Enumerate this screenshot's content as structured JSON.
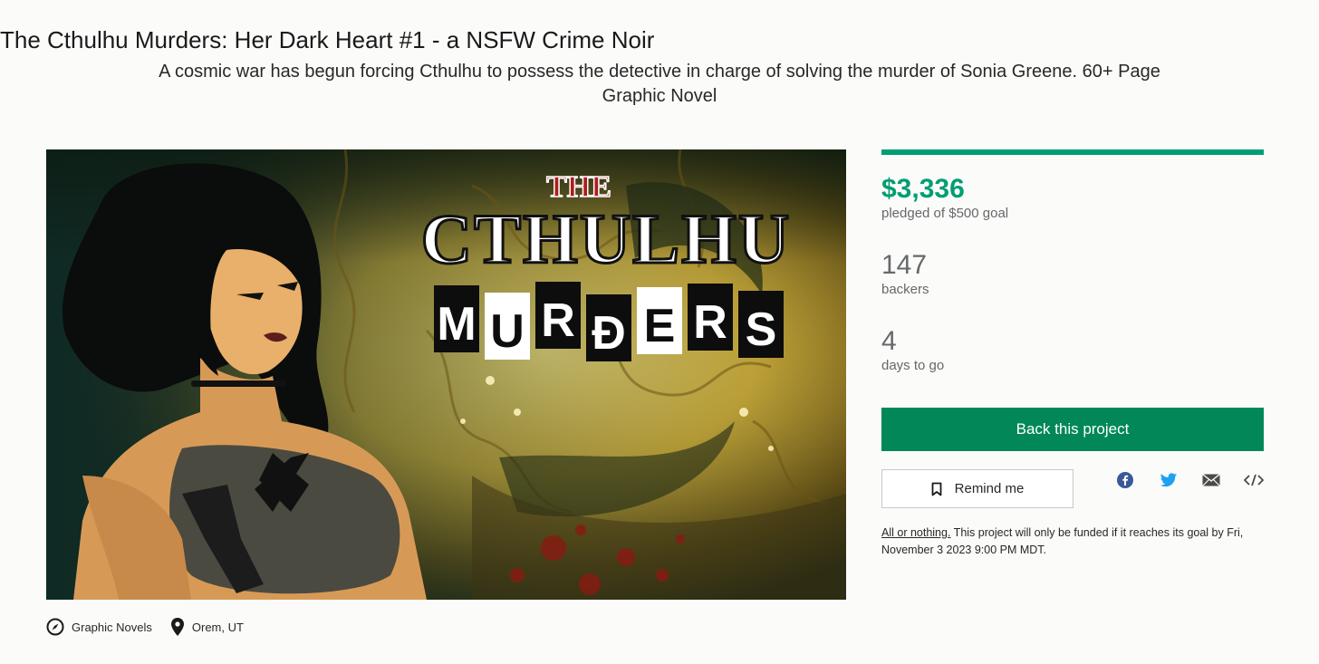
{
  "project": {
    "title": "The Cthulhu Murders: Her Dark Heart #1 - a NSFW Crime Noir",
    "blurb": "A cosmic war has begun forcing Cthulhu to possess the detective in charge of solving the murder of Sonia Greene. 60+ Page Graphic Novel"
  },
  "hero": {
    "logo_the": "THE",
    "logo_cthulhu": "CTHULHU",
    "logo_murders_letters": [
      "M",
      "U",
      "R",
      "Ð",
      "E",
      "R",
      "S"
    ]
  },
  "meta": {
    "category": "Graphic Novels",
    "category_icon": "compass-icon",
    "location": "Orem, UT",
    "location_icon": "map-pin-icon"
  },
  "funding": {
    "progress_fraction": 1.0,
    "pledged": "$3,336",
    "pledged_label": "pledged of $500 goal",
    "backers": "147",
    "backers_label": "backers",
    "days": "4",
    "days_label": "days to go",
    "accent_color": "#009e74",
    "button_color": "#028858"
  },
  "actions": {
    "back_label": "Back this project",
    "remind_label": "Remind me",
    "remind_icon": "bookmark-icon",
    "share_icons": [
      "facebook-icon",
      "twitter-icon",
      "email-icon",
      "embed-icon"
    ]
  },
  "notice": {
    "aon_label": "All or nothing.",
    "text": " This project will only be funded if it reaches its goal by Fri, November 3 2023 9:00 PM MDT."
  }
}
